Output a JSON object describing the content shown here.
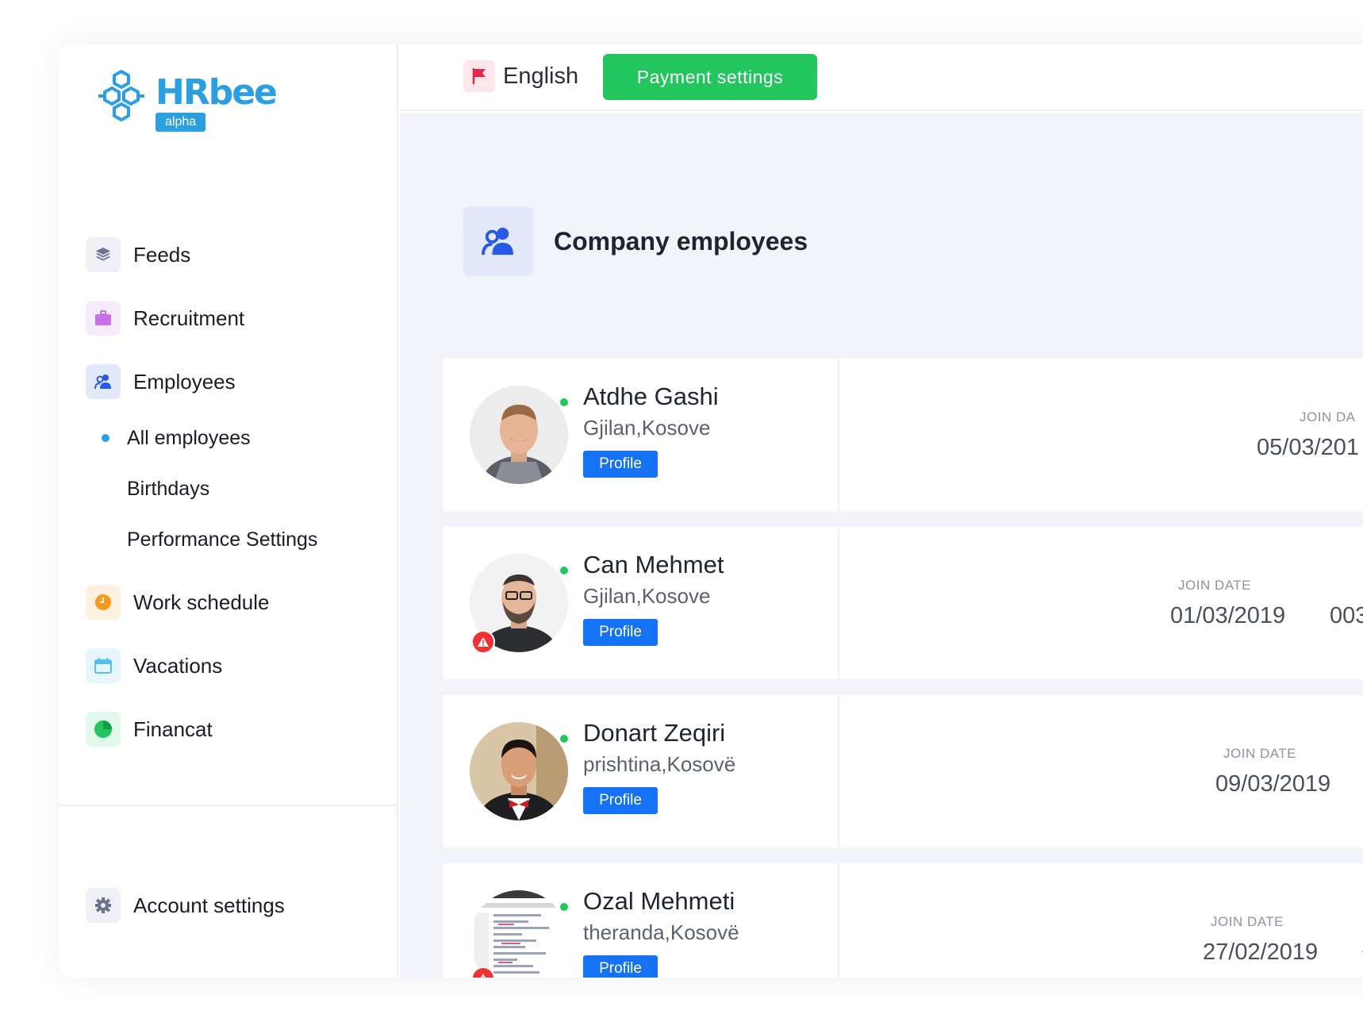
{
  "brand": {
    "name": "HRbee",
    "badge": "alpha"
  },
  "topbar": {
    "language": "English",
    "payment_button": "Payment settings"
  },
  "sidebar": {
    "items": [
      {
        "label": "Feeds",
        "icon": "layers-icon",
        "color": "#6b7391",
        "bg": "#eef0f6"
      },
      {
        "label": "Recruitment",
        "icon": "briefcase-icon",
        "color": "#c772e6",
        "bg": "#f7ecfc"
      },
      {
        "label": "Employees",
        "icon": "users-icon",
        "color": "#2659e6",
        "bg": "#e3e9fb"
      }
    ],
    "subitems": [
      {
        "label": "All employees",
        "active": true
      },
      {
        "label": "Birthdays",
        "active": false
      },
      {
        "label": "Performance Settings",
        "active": false
      }
    ],
    "items2": [
      {
        "label": "Work schedule",
        "icon": "clock-icon",
        "color": "#f59a1f",
        "bg": "#fff1e0"
      },
      {
        "label": "Vacations",
        "icon": "calendar-icon",
        "color": "#52c0f0",
        "bg": "#e7f6fd"
      },
      {
        "label": "Financat",
        "icon": "pie-chart-icon",
        "color": "#22c55e",
        "bg": "#e2f8ea"
      }
    ],
    "account": {
      "label": "Account settings",
      "icon": "gear-icon"
    }
  },
  "page": {
    "title": "Company employees"
  },
  "employees": [
    {
      "name": "Atdhe Gashi",
      "location": "Gjilan,Kosove",
      "profile": "Profile",
      "join_label": "JOIN DA",
      "join_date": "05/03/201",
      "extra": "",
      "online": true,
      "alert": false
    },
    {
      "name": "Can Mehmet",
      "location": "Gjilan,Kosove",
      "profile": "Profile",
      "join_label": "JOIN DATE",
      "join_date": "01/03/2019",
      "extra": "003",
      "online": true,
      "alert": true
    },
    {
      "name": "Donart Zeqiri",
      "location": "prishtina,Kosovë",
      "profile": "Profile",
      "join_label": "JOIN DATE",
      "join_date": "09/03/2019",
      "extra": "",
      "online": true,
      "alert": false
    },
    {
      "name": "Ozal Mehmeti",
      "location": "theranda,Kosovë",
      "profile": "Profile",
      "join_label": "JOIN DATE",
      "join_date": "27/02/2019",
      "extra": "+",
      "online": true,
      "alert": true
    }
  ]
}
